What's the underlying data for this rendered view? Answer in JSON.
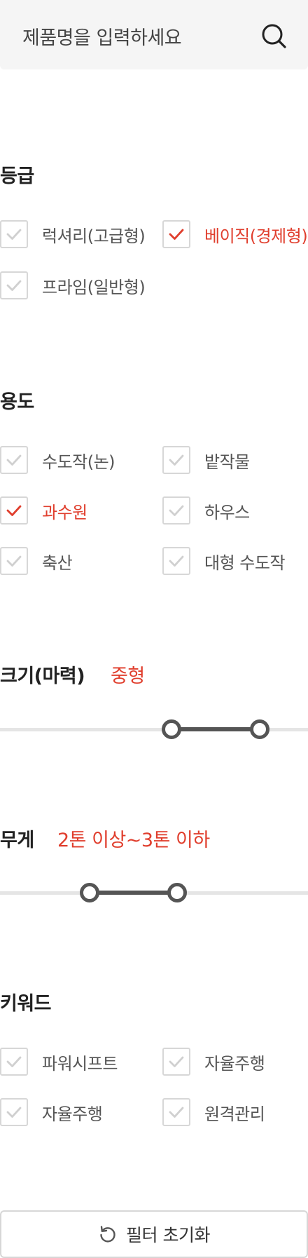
{
  "search": {
    "placeholder": "제품명을 입력하세요"
  },
  "grade": {
    "title": "등급",
    "options": [
      {
        "label": "럭셔리(고급형)",
        "checked": false
      },
      {
        "label": "베이직(경제형)",
        "checked": true
      },
      {
        "label": "프라임(일반형)",
        "checked": false
      }
    ]
  },
  "usage": {
    "title": "용도",
    "options": [
      {
        "label": "수도작(논)",
        "checked": false
      },
      {
        "label": "밭작물",
        "checked": false
      },
      {
        "label": "과수원",
        "checked": true
      },
      {
        "label": "하우스",
        "checked": false
      },
      {
        "label": "축산",
        "checked": false
      },
      {
        "label": "대형 수도작",
        "checked": false
      }
    ]
  },
  "size": {
    "title": "크기(마력)",
    "value": "중형",
    "range": [
      0.557,
      0.843
    ]
  },
  "weight": {
    "title": "무게",
    "value": "2톤 이상~3톤 이하",
    "range": [
      0.29,
      0.575
    ]
  },
  "keyword": {
    "title": "키워드",
    "options": [
      {
        "label": "파워시프트",
        "checked": false
      },
      {
        "label": "자율주행",
        "checked": false
      },
      {
        "label": "자율주행",
        "checked": false
      },
      {
        "label": "원격관리",
        "checked": false
      }
    ]
  },
  "reset": {
    "label": "필터 초기화"
  },
  "colors": {
    "accent": "#e03e2d",
    "unchecked_mark": "#d0d0d0",
    "slider": "#555555"
  },
  "icons": {
    "search": "search-icon",
    "reset": "refresh-icon",
    "check": "check-icon"
  }
}
